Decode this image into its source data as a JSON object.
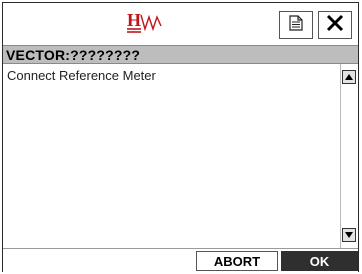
{
  "header": {
    "logo_label": "HW",
    "document_icon": "document-icon",
    "close_icon": "close-icon"
  },
  "title": "VECTOR:????????",
  "content": {
    "message": "Connect Reference Meter"
  },
  "scrollbar": {
    "up_icon": "arrow-up-icon",
    "down_icon": "arrow-down-icon"
  },
  "footer": {
    "abort_label": "ABORT",
    "ok_label": "OK"
  },
  "colors": {
    "logo_red": "#c0161b",
    "title_bar": "#bdbdbd",
    "ok_button": "#2f2f2f"
  }
}
